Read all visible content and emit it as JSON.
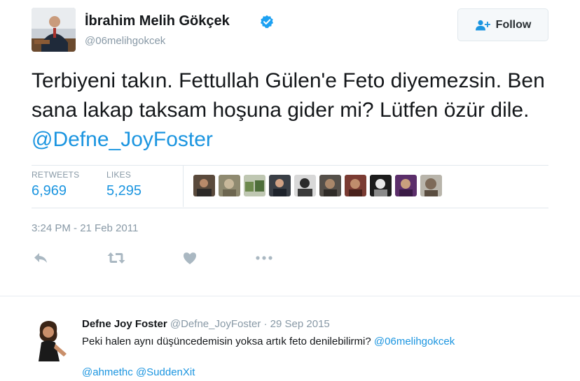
{
  "tweet": {
    "author": {
      "name": "İbrahim Melih Gökçek",
      "handle": "@06melihgokcek",
      "verified": true
    },
    "follow_label": "Follow",
    "text_main": "Terbiyeni takın. Fettullah Gülen'e Feto diyemezsin. Ben sana lakap taksam hoşuna gider mi? Lütfen özür dile.",
    "text_mention": "@Defne_JoyFoster",
    "stats": {
      "retweets_label": "RETWEETS",
      "retweets_value": "6,969",
      "likes_label": "LIKES",
      "likes_value": "5,295"
    },
    "liker_avatar_count": 10,
    "timestamp": "3:24 PM - 21 Feb 2011",
    "actions": [
      "reply-icon",
      "retweet-icon",
      "like-icon",
      "more-icon"
    ]
  },
  "reply": {
    "name": "Defne Joy Foster",
    "handle": "@Defne_JoyFoster",
    "separator": "·",
    "date": "29 Sep 2015",
    "text": "Peki halen aynı düşüncedemisin yoksa artık feto denilebilirmi?",
    "text_mention": "@06melihgokcek",
    "mention_1": "@ahmethc",
    "mention_2": "@SuddenXit"
  },
  "colors": {
    "link": "#1b95e0",
    "muted": "#8899a6",
    "text": "#14171a",
    "verified": "#1da1f2",
    "border": "#e1e8ed"
  }
}
